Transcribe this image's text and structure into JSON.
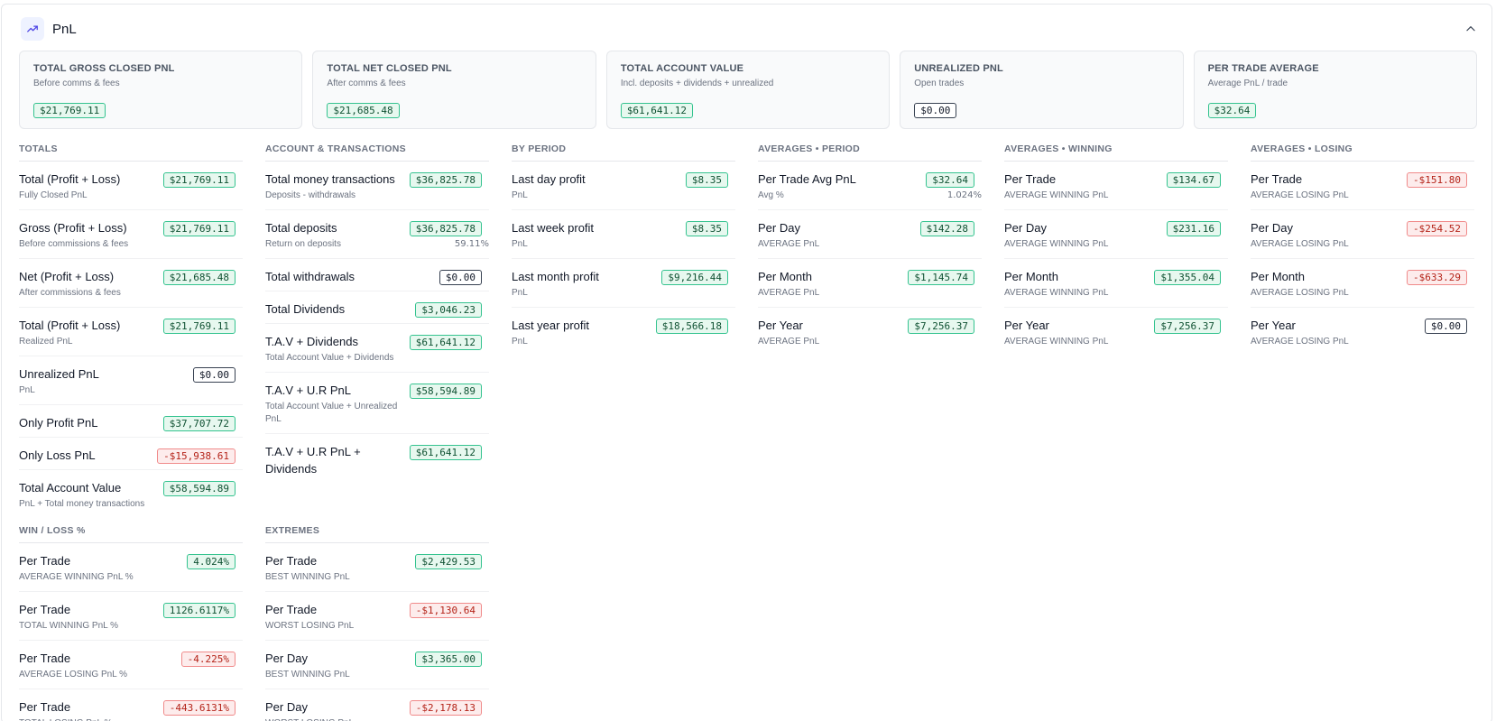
{
  "header": {
    "title": "PnL",
    "icon": "trending-up-icon",
    "collapse_icon": "chevron-up-icon"
  },
  "colors": {
    "positive": "#34c38f",
    "negative": "#f08a8a",
    "accent": "#4f46e5"
  },
  "summary_cards": [
    {
      "title": "TOTAL GROSS CLOSED PNL",
      "subtitle": "Before comms & fees",
      "value": "$21,769.11",
      "tone": "pos"
    },
    {
      "title": "TOTAL NET CLOSED PNL",
      "subtitle": "After comms & fees",
      "value": "$21,685.48",
      "tone": "pos"
    },
    {
      "title": "TOTAL ACCOUNT VALUE",
      "subtitle": "Incl. deposits + dividends + unrealized",
      "value": "$61,641.12",
      "tone": "pos"
    },
    {
      "title": "UNREALIZED PNL",
      "subtitle": "Open trades",
      "value": "$0.00",
      "tone": "neu"
    },
    {
      "title": "PER TRADE AVERAGE",
      "subtitle": "Average PnL / trade",
      "value": "$32.64",
      "tone": "pos"
    }
  ],
  "sections": {
    "totals": {
      "title": "TOTALS",
      "rows": [
        {
          "label": "Total (Profit + Loss)",
          "sub": "Fully Closed PnL",
          "value": "$21,769.11",
          "tone": "pos"
        },
        {
          "label": "Gross (Profit + Loss)",
          "sub": "Before commissions & fees",
          "value": "$21,769.11",
          "tone": "pos"
        },
        {
          "label": "Net (Profit + Loss)",
          "sub": "After commissions & fees",
          "value": "$21,685.48",
          "tone": "pos"
        },
        {
          "label": "Total (Profit + Loss)",
          "sub": "Realized PnL",
          "value": "$21,769.11",
          "tone": "pos"
        },
        {
          "label": "Unrealized PnL",
          "sub": "PnL",
          "value": "$0.00",
          "tone": "neu"
        },
        {
          "label": "Only Profit PnL",
          "sub": "",
          "value": "$37,707.72",
          "tone": "pos"
        },
        {
          "label": "Only Loss PnL",
          "sub": "",
          "value": "-$15,938.61",
          "tone": "neg"
        },
        {
          "label": "Total Account Value",
          "sub": "PnL + Total money transactions",
          "value": "$58,594.89",
          "tone": "pos"
        }
      ]
    },
    "account": {
      "title": "ACCOUNT & TRANSACTIONS",
      "rows": [
        {
          "label": "Total money transactions",
          "sub": "Deposits - withdrawals",
          "value": "$36,825.78",
          "tone": "pos"
        },
        {
          "label": "Total deposits",
          "sub": "Return on deposits",
          "value": "$36,825.78",
          "tone": "pos",
          "extra": "59.11%"
        },
        {
          "label": "Total withdrawals",
          "sub": "",
          "value": "$0.00",
          "tone": "neu"
        },
        {
          "label": "Total Dividends",
          "sub": "",
          "value": "$3,046.23",
          "tone": "pos"
        },
        {
          "label": "T.A.V + Dividends",
          "sub": "Total Account Value + Dividends",
          "value": "$61,641.12",
          "tone": "pos"
        },
        {
          "label": "T.A.V + U.R PnL",
          "sub": "Total Account Value + Unrealized PnL",
          "value": "$58,594.89",
          "tone": "pos"
        },
        {
          "label": "T.A.V + U.R PnL + Dividends",
          "sub": "",
          "value": "$61,641.12",
          "tone": "pos"
        }
      ]
    },
    "period": {
      "title": "BY PERIOD",
      "rows": [
        {
          "label": "Last day profit",
          "sub": "PnL",
          "value": "$8.35",
          "tone": "pos"
        },
        {
          "label": "Last week profit",
          "sub": "PnL",
          "value": "$8.35",
          "tone": "pos"
        },
        {
          "label": "Last month profit",
          "sub": "PnL",
          "value": "$9,216.44",
          "tone": "pos"
        },
        {
          "label": "Last year profit",
          "sub": "PnL",
          "value": "$18,566.18",
          "tone": "pos"
        }
      ]
    },
    "avg_period": {
      "title": "AVERAGES • PERIOD",
      "rows": [
        {
          "label": "Per Trade Avg PnL",
          "sub": "Avg %",
          "value": "$32.64",
          "tone": "pos",
          "extra": "1.024%"
        },
        {
          "label": "Per Day",
          "sub": "AVERAGE PnL",
          "value": "$142.28",
          "tone": "pos"
        },
        {
          "label": "Per Month",
          "sub": "AVERAGE PnL",
          "value": "$1,145.74",
          "tone": "pos"
        },
        {
          "label": "Per Year",
          "sub": "AVERAGE PnL",
          "value": "$7,256.37",
          "tone": "pos"
        }
      ]
    },
    "avg_winning": {
      "title": "AVERAGES • WINNING",
      "rows": [
        {
          "label": "Per Trade",
          "sub": "AVERAGE WINNING PnL",
          "value": "$134.67",
          "tone": "pos"
        },
        {
          "label": "Per Day",
          "sub": "AVERAGE WINNING PnL",
          "value": "$231.16",
          "tone": "pos"
        },
        {
          "label": "Per Month",
          "sub": "AVERAGE WINNING PnL",
          "value": "$1,355.04",
          "tone": "pos"
        },
        {
          "label": "Per Year",
          "sub": "AVERAGE WINNING PnL",
          "value": "$7,256.37",
          "tone": "pos"
        }
      ]
    },
    "avg_losing": {
      "title": "AVERAGES • LOSING",
      "rows": [
        {
          "label": "Per Trade",
          "sub": "AVERAGE LOSING PnL",
          "value": "-$151.80",
          "tone": "neg"
        },
        {
          "label": "Per Day",
          "sub": "AVERAGE LOSING PnL",
          "value": "-$254.52",
          "tone": "neg"
        },
        {
          "label": "Per Month",
          "sub": "AVERAGE LOSING PnL",
          "value": "-$633.29",
          "tone": "neg"
        },
        {
          "label": "Per Year",
          "sub": "AVERAGE LOSING PnL",
          "value": "$0.00",
          "tone": "neu"
        }
      ]
    },
    "win_loss": {
      "title": "WIN / LOSS %",
      "rows": [
        {
          "label": "Per Trade",
          "sub": "AVERAGE WINNING PnL %",
          "value": "4.024%",
          "tone": "pos"
        },
        {
          "label": "Per Trade",
          "sub": "TOTAL WINNING PnL %",
          "value": "1126.6117%",
          "tone": "pos"
        },
        {
          "label": "Per Trade",
          "sub": "AVERAGE LOSING PnL %",
          "value": "-4.225%",
          "tone": "neg"
        },
        {
          "label": "Per Trade",
          "sub": "TOTAL LOSING PnL %",
          "value": "-443.6131%",
          "tone": "neg"
        }
      ]
    },
    "extremes": {
      "title": "EXTREMES",
      "rows": [
        {
          "label": "Per Trade",
          "sub": "BEST WINNING PnL",
          "value": "$2,429.53",
          "tone": "pos"
        },
        {
          "label": "Per Trade",
          "sub": "WORST LOSING PnL",
          "value": "-$1,130.64",
          "tone": "neg"
        },
        {
          "label": "Per Day",
          "sub": "BEST WINNING PnL",
          "value": "$3,365.00",
          "tone": "pos"
        },
        {
          "label": "Per Day",
          "sub": "WORST LOSING PnL",
          "value": "-$2,178.13",
          "tone": "neg"
        }
      ]
    }
  }
}
